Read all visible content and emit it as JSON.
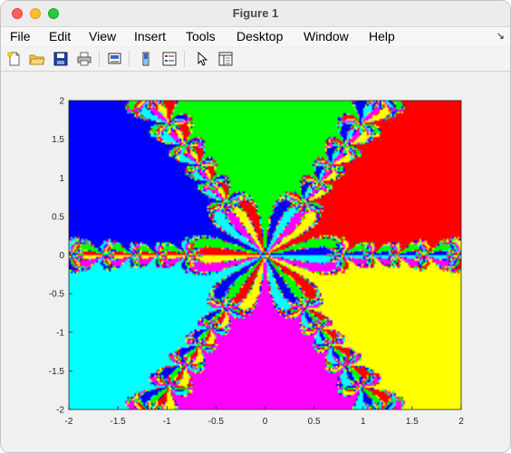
{
  "window": {
    "title": "Figure 1"
  },
  "menu": [
    "File",
    "Edit",
    "View",
    "Insert",
    "Tools",
    "Desktop",
    "Window",
    "Help"
  ],
  "toolbar": {
    "icons": [
      "new-figure-icon",
      "open-file-icon",
      "save-icon",
      "print-icon",
      "link-plot-icon",
      "colorbar-icon",
      "legend-icon",
      "pointer-icon",
      "property-inspector-icon"
    ]
  },
  "chart_data": {
    "type": "heatmap",
    "title": "",
    "xlabel": "",
    "ylabel": "",
    "xlim": [
      -2,
      2
    ],
    "ylim": [
      -2,
      2
    ],
    "x_ticks": [
      "-2",
      "-1.5",
      "-1",
      "-0.5",
      "0",
      "0.5",
      "1",
      "1.5",
      "2"
    ],
    "y_ticks": [
      "2",
      "1.5",
      "1",
      "0.5",
      "0",
      "-0.5",
      "-1",
      "-1.5",
      "-2"
    ],
    "grid": false,
    "colors": {
      "red": "#ff0000",
      "yellow": "#ffff00",
      "magenta": "#ff00ff",
      "cyan": "#00ffff",
      "blue": "#0000ff",
      "green": "#00ff00"
    },
    "basins": [
      {
        "color": "red",
        "region": "upper-right"
      },
      {
        "color": "yellow",
        "region": "right"
      },
      {
        "color": "magenta",
        "region": "lower-right"
      },
      {
        "color": "cyan",
        "region": "lower-left"
      },
      {
        "color": "blue",
        "region": "left"
      },
      {
        "color": "green",
        "region": "upper-left"
      }
    ]
  }
}
